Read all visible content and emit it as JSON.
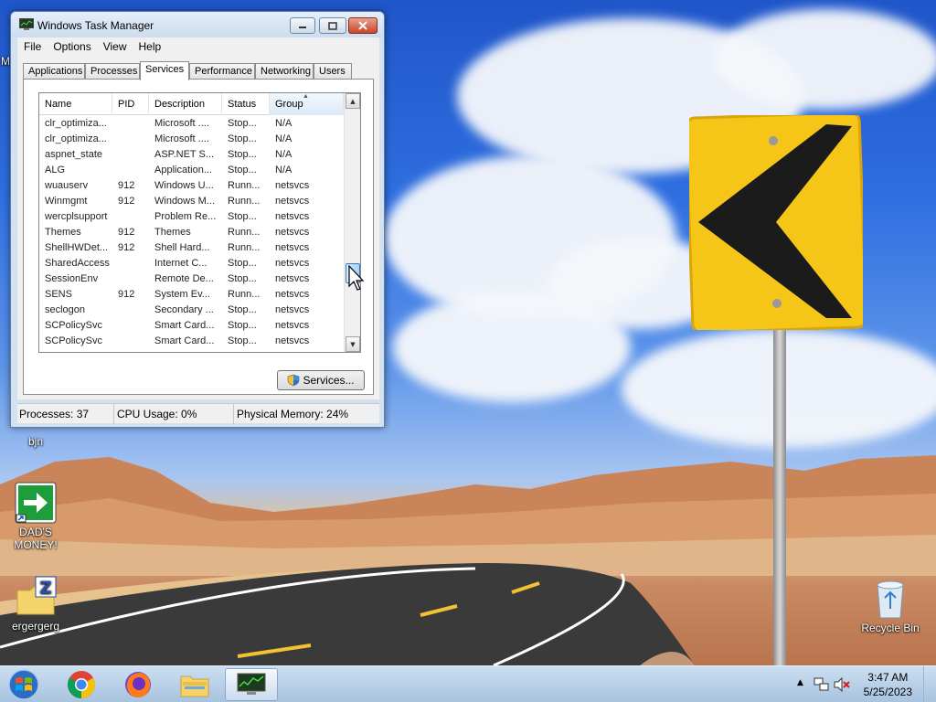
{
  "desktop": {
    "icons": [
      {
        "label": "bjn"
      },
      {
        "label": "DAD'S MONEY!"
      },
      {
        "label": "ergergerg"
      },
      {
        "label": "Recycle Bin"
      }
    ],
    "edge_label": "M"
  },
  "window": {
    "title": "Windows Task Manager",
    "menu": [
      "File",
      "Options",
      "View",
      "Help"
    ],
    "tabs": [
      "Applications",
      "Processes",
      "Services",
      "Performance",
      "Networking",
      "Users"
    ],
    "active_tab": "Services",
    "columns": [
      "Name",
      "PID",
      "Description",
      "Status",
      "Group"
    ],
    "sorted_column": "Group",
    "rows": [
      [
        "clr_optimiza...",
        "",
        "Microsoft ....",
        "Stop...",
        "N/A"
      ],
      [
        "clr_optimiza...",
        "",
        "Microsoft ....",
        "Stop...",
        "N/A"
      ],
      [
        "aspnet_state",
        "",
        "ASP.NET S...",
        "Stop...",
        "N/A"
      ],
      [
        "ALG",
        "",
        "Application...",
        "Stop...",
        "N/A"
      ],
      [
        "wuauserv",
        "912",
        "Windows U...",
        "Runn...",
        "netsvcs"
      ],
      [
        "Winmgmt",
        "912",
        "Windows M...",
        "Runn...",
        "netsvcs"
      ],
      [
        "wercplsupport",
        "",
        "Problem Re...",
        "Stop...",
        "netsvcs"
      ],
      [
        "Themes",
        "912",
        "Themes",
        "Runn...",
        "netsvcs"
      ],
      [
        "ShellHWDet...",
        "912",
        "Shell Hard...",
        "Runn...",
        "netsvcs"
      ],
      [
        "SharedAccess",
        "",
        "Internet C...",
        "Stop...",
        "netsvcs"
      ],
      [
        "SessionEnv",
        "",
        "Remote De...",
        "Stop...",
        "netsvcs"
      ],
      [
        "SENS",
        "912",
        "System Ev...",
        "Runn...",
        "netsvcs"
      ],
      [
        "seclogon",
        "",
        "Secondary ...",
        "Stop...",
        "netsvcs"
      ],
      [
        "SCPolicySvc",
        "",
        "Smart Card...",
        "Stop...",
        "netsvcs"
      ],
      [
        "SCPolicySvc",
        "",
        "Smart Card...",
        "Stop...",
        "netsvcs"
      ]
    ],
    "services_button": "Services...",
    "status": {
      "processes": "Processes: 37",
      "cpu": "CPU Usage: 0%",
      "memory": "Physical Memory: 24%"
    }
  },
  "taskbar": {
    "time": "3:47 AM",
    "date": "5/25/2023"
  },
  "colors": {
    "accent": "#3b7bbf",
    "close_button": "#c8452b",
    "sign_yellow": "#f5c518"
  }
}
